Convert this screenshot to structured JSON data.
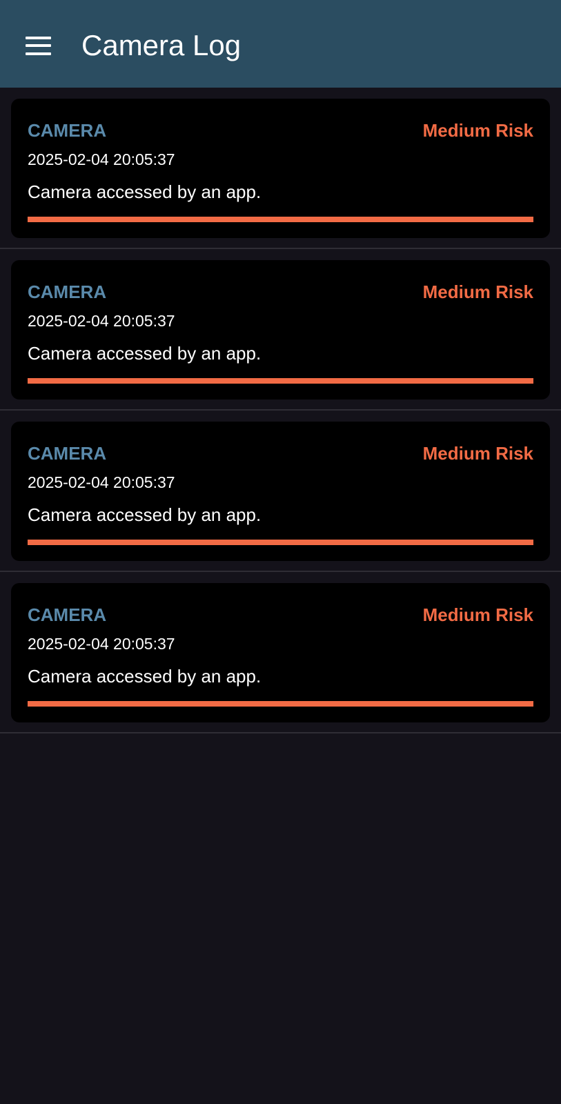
{
  "app_bar": {
    "title": "Camera Log",
    "menu_icon": "hamburger-menu-icon",
    "background_color": "#2b4d61"
  },
  "colors": {
    "page_background": "#14121a",
    "card_background": "#000000",
    "type_text": "#5a8aab",
    "risk_medium": "#f26b45"
  },
  "logs": [
    {
      "type": "CAMERA",
      "risk": "Medium Risk",
      "timestamp": "2025-02-04 20:05:37",
      "description": "Camera accessed by an app.",
      "risk_level_fraction": 1.0
    },
    {
      "type": "CAMERA",
      "risk": "Medium Risk",
      "timestamp": "2025-02-04 20:05:37",
      "description": "Camera accessed by an app.",
      "risk_level_fraction": 1.0
    },
    {
      "type": "CAMERA",
      "risk": "Medium Risk",
      "timestamp": "2025-02-04 20:05:37",
      "description": "Camera accessed by an app.",
      "risk_level_fraction": 1.0
    },
    {
      "type": "CAMERA",
      "risk": "Medium Risk",
      "timestamp": "2025-02-04 20:05:37",
      "description": "Camera accessed by an app.",
      "risk_level_fraction": 1.0
    }
  ]
}
